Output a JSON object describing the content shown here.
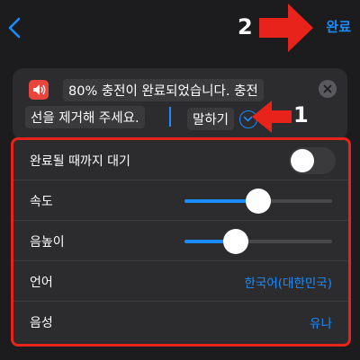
{
  "nav": {
    "back_icon": "chevron-left-icon",
    "done_label": "완료"
  },
  "annotations": {
    "step_2": "2",
    "step_1": "1",
    "arrow_color": "#e8231c"
  },
  "text_card": {
    "line_1": "80% 충전이 완료되었습니다. 충전",
    "line_2": "선을 제거해 주세요.",
    "speak_label": "말하기",
    "speaker_icon": "speaker-icon",
    "clear_icon": "clear-icon",
    "expand_icon": "chevron-down-circle-icon"
  },
  "settings": {
    "rows": [
      {
        "label": "완료될 때까지 대기",
        "control": "toggle",
        "on": false
      },
      {
        "label": "속도",
        "control": "slider",
        "value": 0.5
      },
      {
        "label": "음높이",
        "control": "slider",
        "value": 0.35
      },
      {
        "label": "언어",
        "control": "value",
        "value": "한국어(대한민국)"
      },
      {
        "label": "음성",
        "control": "value",
        "value": "유나"
      }
    ]
  },
  "colors": {
    "accent": "#1a8cff",
    "highlight_border": "#e8231c",
    "speaker": "#e8453c"
  }
}
